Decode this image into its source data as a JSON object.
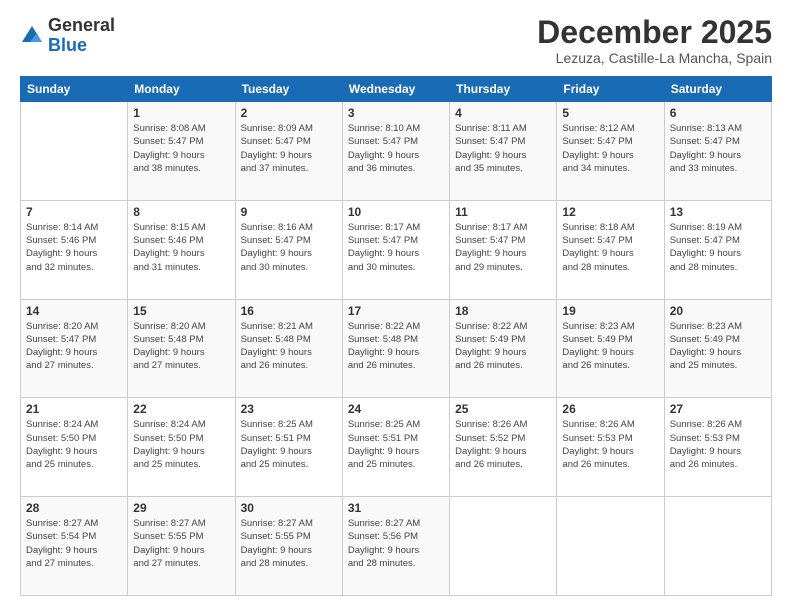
{
  "logo": {
    "general": "General",
    "blue": "Blue"
  },
  "header": {
    "month_title": "December 2025",
    "location": "Lezuza, Castille-La Mancha, Spain"
  },
  "days_of_week": [
    "Sunday",
    "Monday",
    "Tuesday",
    "Wednesday",
    "Thursday",
    "Friday",
    "Saturday"
  ],
  "weeks": [
    [
      {
        "day": "",
        "text": ""
      },
      {
        "day": "1",
        "text": "Sunrise: 8:08 AM\nSunset: 5:47 PM\nDaylight: 9 hours\nand 38 minutes."
      },
      {
        "day": "2",
        "text": "Sunrise: 8:09 AM\nSunset: 5:47 PM\nDaylight: 9 hours\nand 37 minutes."
      },
      {
        "day": "3",
        "text": "Sunrise: 8:10 AM\nSunset: 5:47 PM\nDaylight: 9 hours\nand 36 minutes."
      },
      {
        "day": "4",
        "text": "Sunrise: 8:11 AM\nSunset: 5:47 PM\nDaylight: 9 hours\nand 35 minutes."
      },
      {
        "day": "5",
        "text": "Sunrise: 8:12 AM\nSunset: 5:47 PM\nDaylight: 9 hours\nand 34 minutes."
      },
      {
        "day": "6",
        "text": "Sunrise: 8:13 AM\nSunset: 5:47 PM\nDaylight: 9 hours\nand 33 minutes."
      }
    ],
    [
      {
        "day": "7",
        "text": "Sunrise: 8:14 AM\nSunset: 5:46 PM\nDaylight: 9 hours\nand 32 minutes."
      },
      {
        "day": "8",
        "text": "Sunrise: 8:15 AM\nSunset: 5:46 PM\nDaylight: 9 hours\nand 31 minutes."
      },
      {
        "day": "9",
        "text": "Sunrise: 8:16 AM\nSunset: 5:47 PM\nDaylight: 9 hours\nand 30 minutes."
      },
      {
        "day": "10",
        "text": "Sunrise: 8:17 AM\nSunset: 5:47 PM\nDaylight: 9 hours\nand 30 minutes."
      },
      {
        "day": "11",
        "text": "Sunrise: 8:17 AM\nSunset: 5:47 PM\nDaylight: 9 hours\nand 29 minutes."
      },
      {
        "day": "12",
        "text": "Sunrise: 8:18 AM\nSunset: 5:47 PM\nDaylight: 9 hours\nand 28 minutes."
      },
      {
        "day": "13",
        "text": "Sunrise: 8:19 AM\nSunset: 5:47 PM\nDaylight: 9 hours\nand 28 minutes."
      }
    ],
    [
      {
        "day": "14",
        "text": "Sunrise: 8:20 AM\nSunset: 5:47 PM\nDaylight: 9 hours\nand 27 minutes."
      },
      {
        "day": "15",
        "text": "Sunrise: 8:20 AM\nSunset: 5:48 PM\nDaylight: 9 hours\nand 27 minutes."
      },
      {
        "day": "16",
        "text": "Sunrise: 8:21 AM\nSunset: 5:48 PM\nDaylight: 9 hours\nand 26 minutes."
      },
      {
        "day": "17",
        "text": "Sunrise: 8:22 AM\nSunset: 5:48 PM\nDaylight: 9 hours\nand 26 minutes."
      },
      {
        "day": "18",
        "text": "Sunrise: 8:22 AM\nSunset: 5:49 PM\nDaylight: 9 hours\nand 26 minutes."
      },
      {
        "day": "19",
        "text": "Sunrise: 8:23 AM\nSunset: 5:49 PM\nDaylight: 9 hours\nand 26 minutes."
      },
      {
        "day": "20",
        "text": "Sunrise: 8:23 AM\nSunset: 5:49 PM\nDaylight: 9 hours\nand 25 minutes."
      }
    ],
    [
      {
        "day": "21",
        "text": "Sunrise: 8:24 AM\nSunset: 5:50 PM\nDaylight: 9 hours\nand 25 minutes."
      },
      {
        "day": "22",
        "text": "Sunrise: 8:24 AM\nSunset: 5:50 PM\nDaylight: 9 hours\nand 25 minutes."
      },
      {
        "day": "23",
        "text": "Sunrise: 8:25 AM\nSunset: 5:51 PM\nDaylight: 9 hours\nand 25 minutes."
      },
      {
        "day": "24",
        "text": "Sunrise: 8:25 AM\nSunset: 5:51 PM\nDaylight: 9 hours\nand 25 minutes."
      },
      {
        "day": "25",
        "text": "Sunrise: 8:26 AM\nSunset: 5:52 PM\nDaylight: 9 hours\nand 26 minutes."
      },
      {
        "day": "26",
        "text": "Sunrise: 8:26 AM\nSunset: 5:53 PM\nDaylight: 9 hours\nand 26 minutes."
      },
      {
        "day": "27",
        "text": "Sunrise: 8:26 AM\nSunset: 5:53 PM\nDaylight: 9 hours\nand 26 minutes."
      }
    ],
    [
      {
        "day": "28",
        "text": "Sunrise: 8:27 AM\nSunset: 5:54 PM\nDaylight: 9 hours\nand 27 minutes."
      },
      {
        "day": "29",
        "text": "Sunrise: 8:27 AM\nSunset: 5:55 PM\nDaylight: 9 hours\nand 27 minutes."
      },
      {
        "day": "30",
        "text": "Sunrise: 8:27 AM\nSunset: 5:55 PM\nDaylight: 9 hours\nand 28 minutes."
      },
      {
        "day": "31",
        "text": "Sunrise: 8:27 AM\nSunset: 5:56 PM\nDaylight: 9 hours\nand 28 minutes."
      },
      {
        "day": "",
        "text": ""
      },
      {
        "day": "",
        "text": ""
      },
      {
        "day": "",
        "text": ""
      }
    ]
  ]
}
